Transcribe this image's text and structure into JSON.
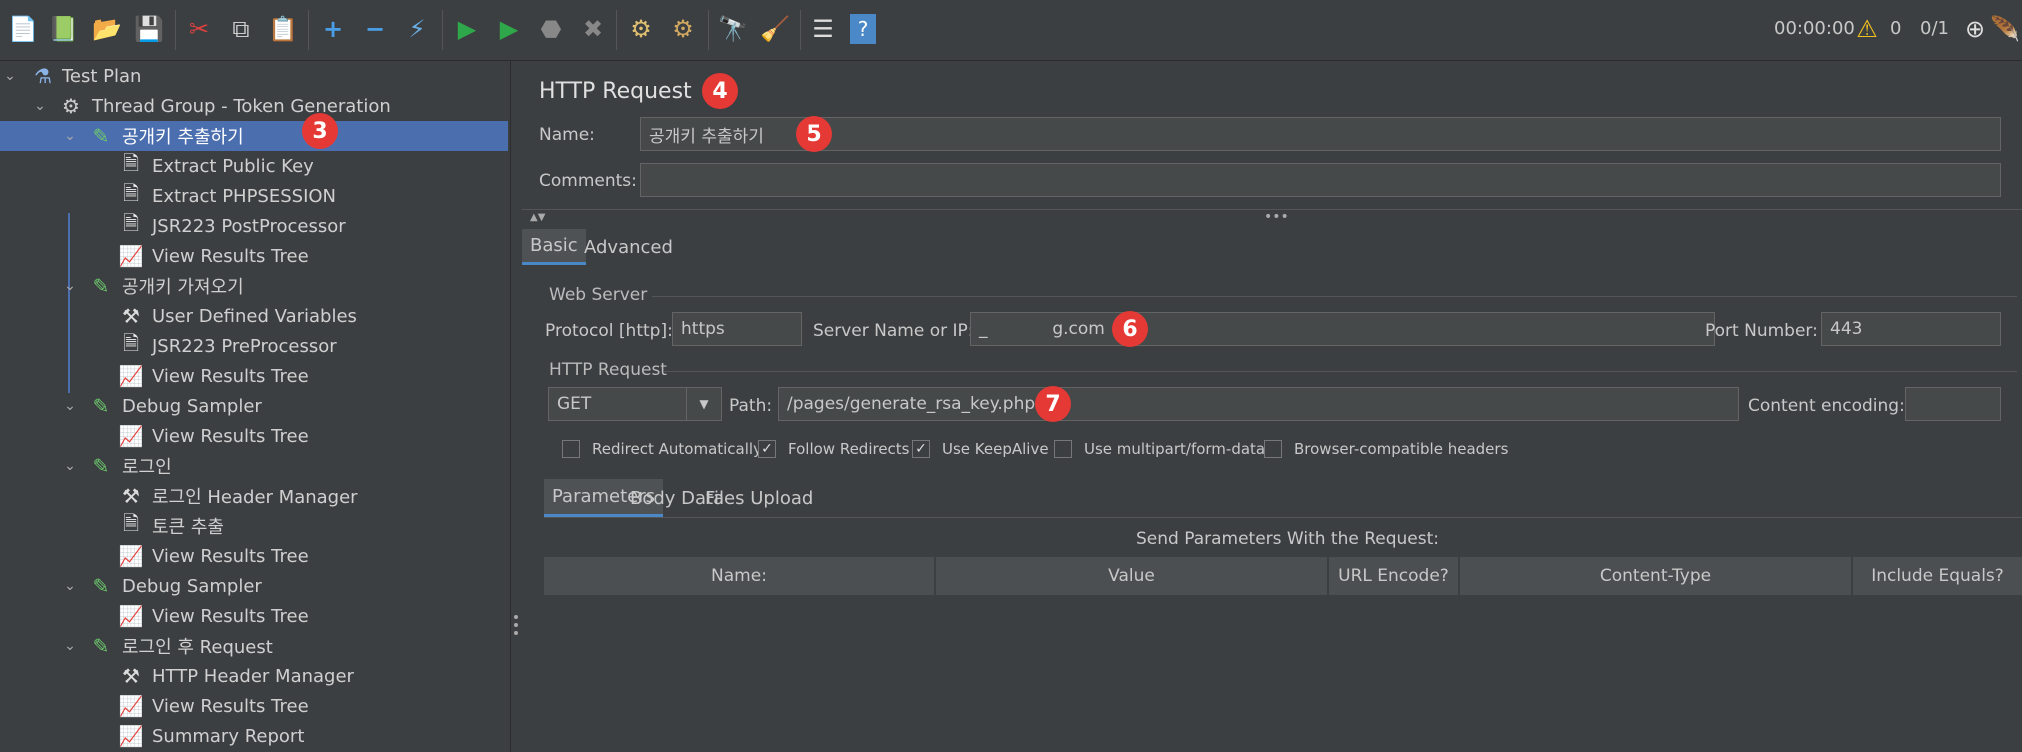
{
  "toolbar": {
    "icons": [
      "new-icon",
      "templates-icon",
      "open-icon",
      "save-icon",
      "cut-icon",
      "copy-icon",
      "paste-icon",
      "expand-icon",
      "collapse-icon",
      "toggle-icon",
      "start-icon",
      "start-no-pause-icon",
      "stop-icon",
      "shutdown-icon",
      "clear-icon",
      "clear-all-icon",
      "search-icon",
      "reset-search-icon",
      "function-helper-icon",
      "help-icon"
    ],
    "timer": "00:00:00",
    "warnings": "0",
    "threads": "0/1"
  },
  "tree": {
    "items": [
      {
        "label": "Test Plan",
        "icon": "flask-icon"
      },
      {
        "label": "Thread Group - Token Generation",
        "icon": "gear-icon"
      },
      {
        "label": "공개키 추출하기",
        "icon": "pipette-icon"
      },
      {
        "label": "Extract Public Key",
        "icon": "document-icon"
      },
      {
        "label": "Extract PHPSESSION",
        "icon": "document-icon"
      },
      {
        "label": "JSR223 PostProcessor",
        "icon": "document-icon"
      },
      {
        "label": "View Results Tree",
        "icon": "chart-icon"
      },
      {
        "label": "공개키 가져오기",
        "icon": "pipette-icon"
      },
      {
        "label": "User Defined Variables",
        "icon": "tools-icon"
      },
      {
        "label": "JSR223 PreProcessor",
        "icon": "document-red-icon"
      },
      {
        "label": "View Results Tree",
        "icon": "chart-icon"
      },
      {
        "label": "Debug Sampler",
        "icon": "pipette-icon"
      },
      {
        "label": "View Results Tree",
        "icon": "chart-icon"
      },
      {
        "label": "로그인",
        "icon": "pipette-icon"
      },
      {
        "label": "로그인 Header Manager",
        "icon": "tools-icon"
      },
      {
        "label": "토큰 추출",
        "icon": "document-icon"
      },
      {
        "label": "View Results Tree",
        "icon": "chart-icon"
      },
      {
        "label": "Debug Sampler",
        "icon": "pipette-icon"
      },
      {
        "label": "View Results Tree",
        "icon": "chart-icon"
      },
      {
        "label": "로그인 후 Request",
        "icon": "pipette-icon"
      },
      {
        "label": "HTTP Header Manager",
        "icon": "tools-icon"
      },
      {
        "label": "View Results Tree",
        "icon": "chart-icon"
      },
      {
        "label": "Summary Report",
        "icon": "chart-icon"
      }
    ]
  },
  "badges": {
    "b3": "3",
    "b4": "4",
    "b5": "5",
    "b6": "6",
    "b7": "7"
  },
  "main": {
    "title": "HTTP Request",
    "name_label": "Name:",
    "name_value": "공개키 추출하기",
    "comments_label": "Comments:",
    "comments_value": "",
    "tabs": [
      "Basic",
      "Advanced"
    ],
    "web_server": {
      "title": "Web Server",
      "protocol_label": "Protocol [http]:",
      "protocol_value": "https",
      "server_label": "Server Name or IP:",
      "server_value": "_            g.com",
      "port_label": "Port Number:",
      "port_value": "443"
    },
    "http_request": {
      "title": "HTTP Request",
      "method": "GET",
      "path_label": "Path:",
      "path_value": "/pages/generate_rsa_key.php",
      "encoding_label": "Content encoding:",
      "encoding_value": ""
    },
    "checkboxes": [
      {
        "label": "Redirect Automatically",
        "checked": false
      },
      {
        "label": "Follow Redirects",
        "checked": true
      },
      {
        "label": "Use KeepAlive",
        "checked": true
      },
      {
        "label": "Use multipart/form-data",
        "checked": false
      },
      {
        "label": "Browser-compatible headers",
        "checked": false
      }
    ],
    "subtabs": [
      "Parameters",
      "Body Data",
      "Files Upload"
    ],
    "params_caption": "Send Parameters With the Request:",
    "table_headers": [
      "Name:",
      "Value",
      "URL Encode?",
      "Content-Type",
      "Include Equals?"
    ]
  }
}
